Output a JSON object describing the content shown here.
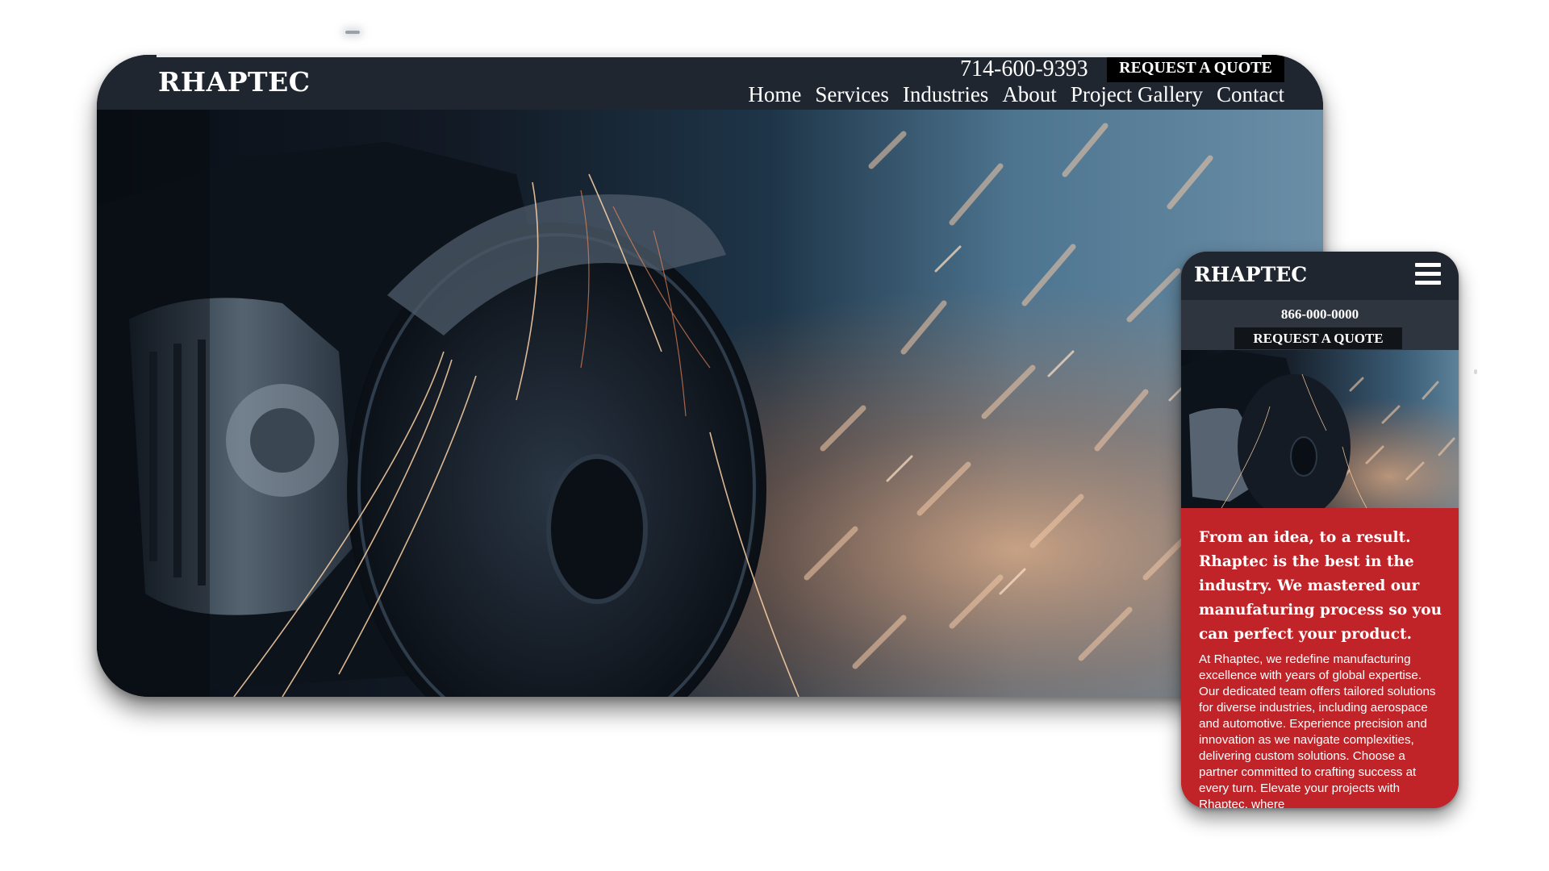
{
  "desktop": {
    "logo": "RHAPTEC",
    "phone": "714-600-9393",
    "cta_label": "REQUEST A QUOTE",
    "nav": [
      {
        "label": "Home"
      },
      {
        "label": "Services"
      },
      {
        "label": "Industries"
      },
      {
        "label": "About"
      },
      {
        "label": "Project Gallery"
      },
      {
        "label": "Contact"
      }
    ],
    "hero_image": "angle-grinder-sparks-photo"
  },
  "mobile": {
    "logo": "RHAPTEC",
    "menu_icon": "hamburger-menu-icon",
    "phone": "866-000-0000",
    "cta_label": "REQUEST A QUOTE",
    "hero_image": "angle-grinder-sparks-photo",
    "heading": "From an idea, to a result. Rhaptec is the best in the industry. We mastered our manufaturing process so you can perfect your product.",
    "body": "At Rhaptec, we redefine manufacturing excellence with years of global expertise. Our dedicated team offers tailored solutions for diverse industries, including aerospace and automotive. Experience precision and innovation as we navigate complexities, delivering custom solutions. Choose a partner committed to crafting success at every turn. Elevate your projects with Rhaptec, where"
  },
  "colors": {
    "header_bg": "#1f2630",
    "subheader_bg": "#2f353e",
    "cta_bg": "#000000",
    "accent_red": "#c02328",
    "text_white": "#ffffff"
  }
}
